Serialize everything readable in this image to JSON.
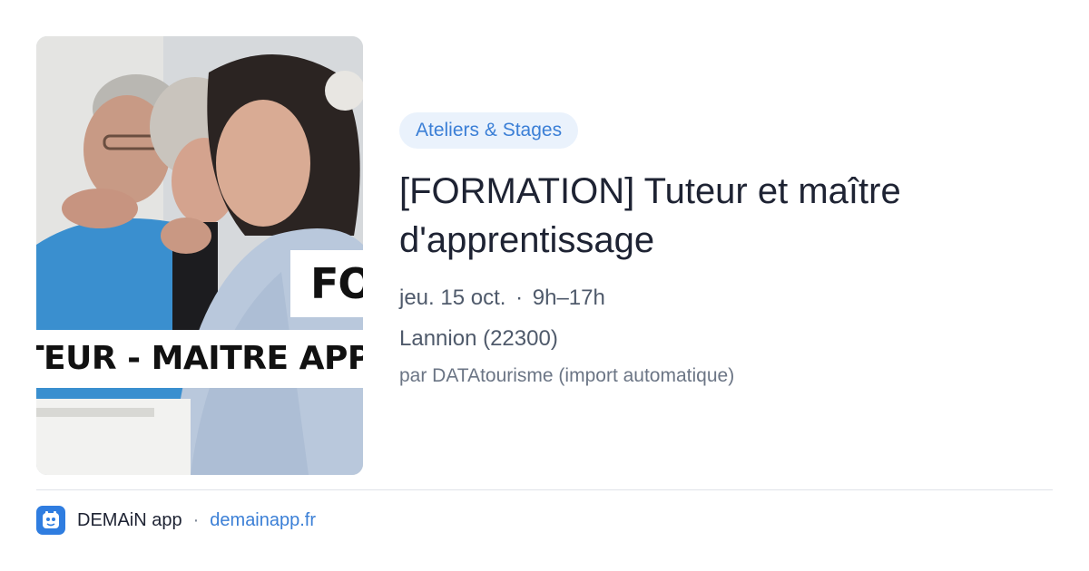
{
  "thumbnail": {
    "overlay_fo": "FO",
    "overlay_band": "TEUR - MAITRE APP"
  },
  "event": {
    "category": "Ateliers & Stages",
    "title": "[FORMATION] Tuteur et maître d'apprentissage",
    "date": "jeu. 15 oct.",
    "time": "9h–17h",
    "separator": "·",
    "location": "Lannion (22300)",
    "source": "par DATAtourisme (import automatique)"
  },
  "footer": {
    "app_name": "DEMAiN app",
    "separator": "·",
    "domain": "demainapp.fr"
  },
  "colors": {
    "accent": "#3b7fd6",
    "badge_bg": "#eaf2fc",
    "icon_bg": "#2f7de0"
  }
}
